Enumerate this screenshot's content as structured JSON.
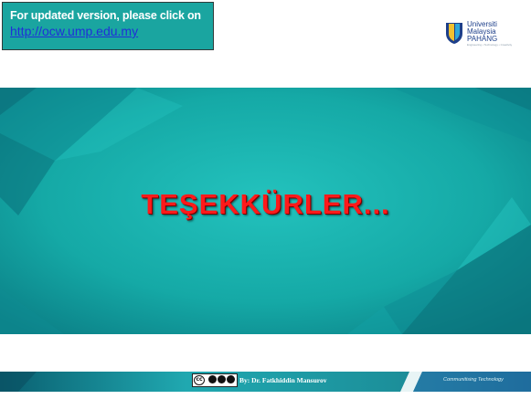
{
  "notice": {
    "text": "For updated version, please click on",
    "link": "http://ocw.ump.edu.my"
  },
  "logo": {
    "line1": "Universiti",
    "line2": "Malaysia",
    "line3": "PAHANG",
    "tagline": "Engineering • Technology • Creativity"
  },
  "banner": {
    "title": "TEŞEKKÜRLER..."
  },
  "footer": {
    "author": "By: Dr. Fatkhiddin Mansurov",
    "motto": "Communitising Technology",
    "license_glyph": "cc"
  },
  "colors": {
    "teal": "#1aa5a0",
    "banner_teal": "#17b3b0",
    "title_red": "#ff1a1a",
    "footer_teal": "#1c8f9a"
  }
}
